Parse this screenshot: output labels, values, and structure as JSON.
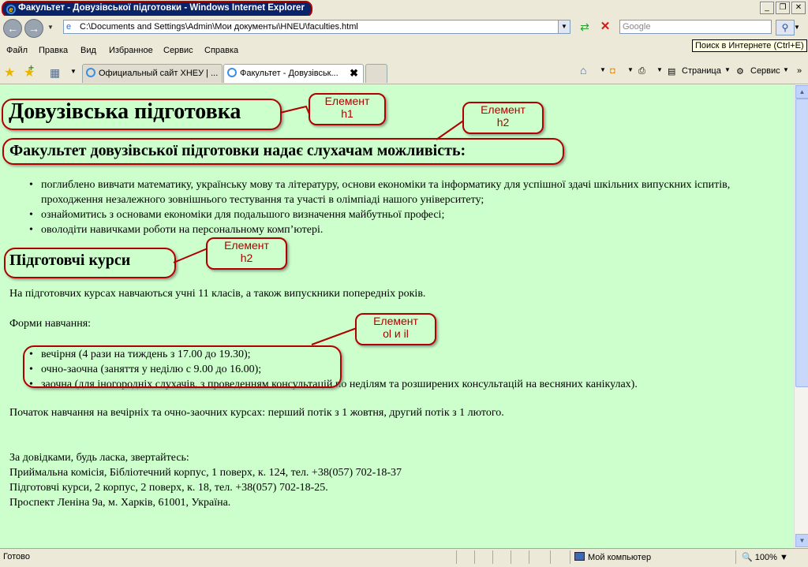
{
  "window": {
    "title": "Факультет - Довузівської підготовки - Windows Internet Explorer",
    "buttons": [
      "_",
      "❐",
      "✕"
    ]
  },
  "address_bar": {
    "url": "C:\\Documents and Settings\\Admin\\Мои документы\\HNEU\\faculties.html",
    "search_placeholder": "Google"
  },
  "tooltip": "Поиск в Интернете (Ctrl+E)",
  "menu": [
    "Файл",
    "Правка",
    "Вид",
    "Избранное",
    "Сервис",
    "Справка"
  ],
  "tabs": [
    {
      "label": "Официальный сайт ХНЕУ | ..."
    },
    {
      "label": "Факультет - Довузівськ...",
      "close": "✖"
    }
  ],
  "command_bar": {
    "page": "Страница",
    "tools": "Сервис"
  },
  "page": {
    "h1": "Довузівська підготовка",
    "h2_faculty": "Факультет довузівської підготовки надає слухачам можливість:",
    "faculty_list": [
      "поглиблено вивчати математику, українську мову та літературу, основи економіки та інформатику для успішної здачі шкільних випускних іспитів, проходження незалежного зовнішнього тестування та участі в олімпіаді нашого університету;",
      "ознайомитись з основами економіки для подальшого визначення майбутньої професі;",
      "оволодіти навичками роботи на персональному комп’ютері."
    ],
    "h2_courses": "Підготовчі курси",
    "courses_text": "На підготовчих курсах навчаються учні 11 класів, а також випускники попередніх років.",
    "forms_label": "Форми навчання:",
    "forms_list": [
      "вечірня (4 рази на тиждень з 17.00 до 19.30);",
      "очно-заочна (заняття у неділю с 9.00 до 16.00);",
      "заочна (для іногородніх слухачів, з проведенням консультацій по неділям та розширених консультацій на весняних канікулах)."
    ],
    "start_text": "Початок навчання на вечірніх та очно-заочних курсах: перший потік з 1 жовтня, другий потік з 1 лютого.",
    "contacts": [
      "За довідками, будь ласка, звертайтесь:",
      "Приймальна комісія, Бібліотечний корпус, 1 поверх, к. 124, тел. +38(057) 702-18-37",
      "Підготовчі курси, 2 корпус, 2 поверх, к. 18, тел. +38(057) 702-18-25.",
      "Проспект Леніна 9а, м. Харків, 61001, Україна."
    ]
  },
  "callouts": {
    "h1": [
      "Елемент",
      "h1"
    ],
    "h2_top": [
      "Елемент",
      "h2"
    ],
    "h2_courses": [
      "Елемент",
      "h2"
    ],
    "list": [
      "Елемент",
      "ol и il"
    ]
  },
  "status": {
    "text": "Готово",
    "zone": "Мой компьютер",
    "zoom": "100%"
  },
  "colors": {
    "page_background": "#ccffcc",
    "annotation_red": "#b00000",
    "title_bar": "#0a246a"
  }
}
